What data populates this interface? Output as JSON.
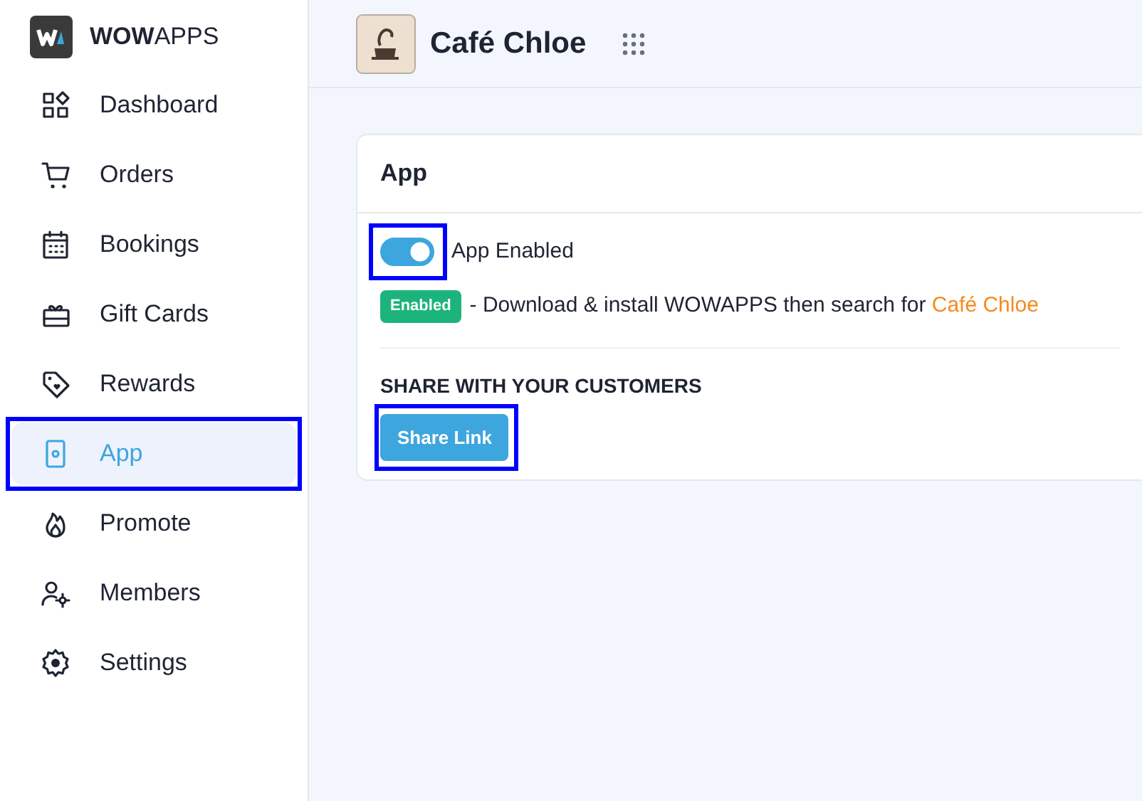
{
  "brand": {
    "name": "**WOW**APPS"
  },
  "sidebar": {
    "items": [
      {
        "label": "Dashboard",
        "selected": false,
        "highlighted": false
      },
      {
        "label": "Orders",
        "selected": false,
        "highlighted": false
      },
      {
        "label": "Bookings",
        "selected": false,
        "highlighted": false
      },
      {
        "label": "Gift Cards",
        "selected": false,
        "highlighted": false
      },
      {
        "label": "Rewards",
        "selected": false,
        "highlighted": false
      },
      {
        "label": "App",
        "selected": true,
        "highlighted": true
      },
      {
        "label": "Promote",
        "selected": false,
        "highlighted": false
      },
      {
        "label": "Members",
        "selected": false,
        "highlighted": false
      },
      {
        "label": "Settings",
        "selected": false,
        "highlighted": false
      }
    ]
  },
  "header": {
    "title": "Café Chloe"
  },
  "card": {
    "title": "App",
    "toggle": {
      "label": "App Enabled",
      "on": true,
      "highlighted": true
    },
    "status": {
      "badge": "Enabled",
      "text": "- Download & install WOWAPPS then search for",
      "link": "Café Chloe"
    },
    "share_heading": "SHARE WITH YOUR CUSTOMERS",
    "share_button": {
      "label": "Share Link",
      "highlighted": true
    }
  }
}
